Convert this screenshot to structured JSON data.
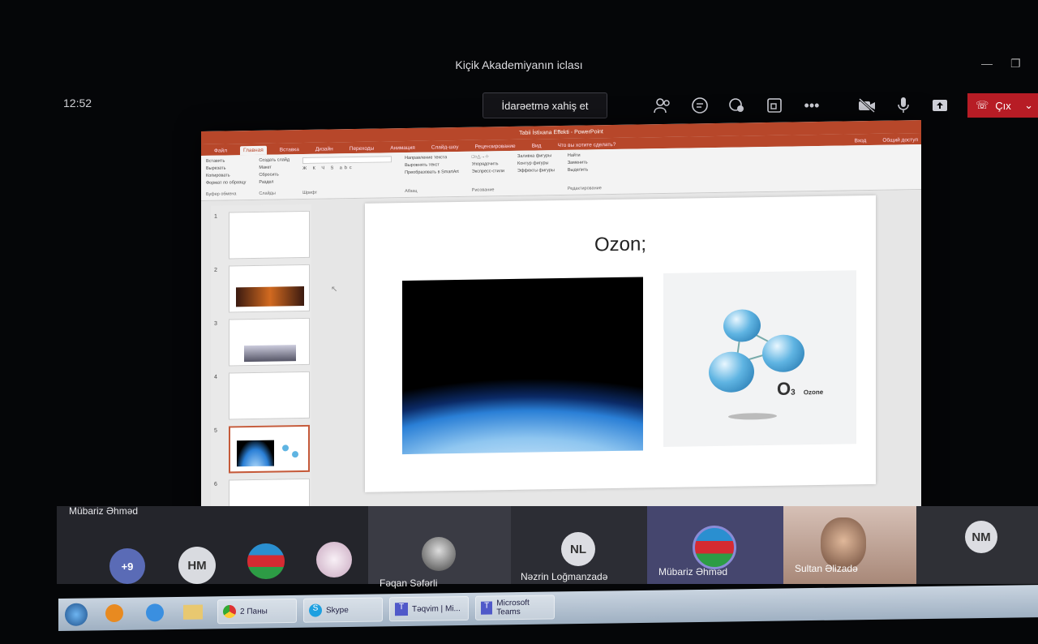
{
  "meeting": {
    "title": "Kiçik Akademiyanın iclası",
    "time": "12:52"
  },
  "toolbar": {
    "request_control": "İdarəetmə xahiş et",
    "leave_label": "Çıx"
  },
  "presentation": {
    "app_title": "Tabii İstixana Effekti - PowerPoint",
    "tabs": [
      "Файл",
      "Главная",
      "Вставка",
      "Дизайн",
      "Переходы",
      "Анимация",
      "Слайд-шоу",
      "Рецензирование",
      "Вид"
    ],
    "search_hint": "Что вы хотите сделать?",
    "share": "Общий доступ",
    "login": "Вход",
    "ribbon": {
      "clipboard": {
        "paste": "Вставить",
        "cut": "Вырезать",
        "copy": "Копировать",
        "format": "Формат по образцу",
        "group": "Буфер обмена"
      },
      "slides": {
        "new": "Создать слайд",
        "layout": "Макет",
        "reset": "Сбросить",
        "section": "Раздел",
        "group": "Слайды"
      },
      "font_group": "Шрифт",
      "paragraph": {
        "direction": "Направление текста",
        "align": "Выровнять текст",
        "smartart": "Преобразовать в SmartArt",
        "group": "Абзац"
      },
      "drawing": {
        "arrange": "Упорядочить",
        "styles": "Экспресс-стили",
        "fill": "Заливка фигуры",
        "outline": "Контур фигуры",
        "effects": "Эффекты фигуры",
        "group": "Рисование"
      },
      "editing": {
        "find": "Найти",
        "replace": "Заменить",
        "select": "Выделить",
        "group": "Редактирование"
      }
    },
    "thumb_numbers": [
      "1",
      "2",
      "3",
      "4",
      "5",
      "6"
    ],
    "slide_title": "Ozon;",
    "ozone_label_big": "O",
    "ozone_label_sub": "3",
    "ozone_word": "Ozone"
  },
  "presenter_name": "Mübariz Əhməd",
  "participants": [
    {
      "initials": "+9"
    },
    {
      "initials": "HM"
    },
    {
      "name": "Fəqan Səfərli"
    },
    {
      "initials": "NL",
      "name": "Nəzrin Loğmanzadə"
    },
    {
      "name": "Mübariz Əhməd"
    },
    {
      "name": "Sultan Əlizadə"
    },
    {
      "initials": "NM"
    }
  ],
  "taskbar": {
    "items": [
      "2 Паны",
      "Skype",
      "Təqvim | Mi...",
      "Microsoft Teams"
    ]
  }
}
